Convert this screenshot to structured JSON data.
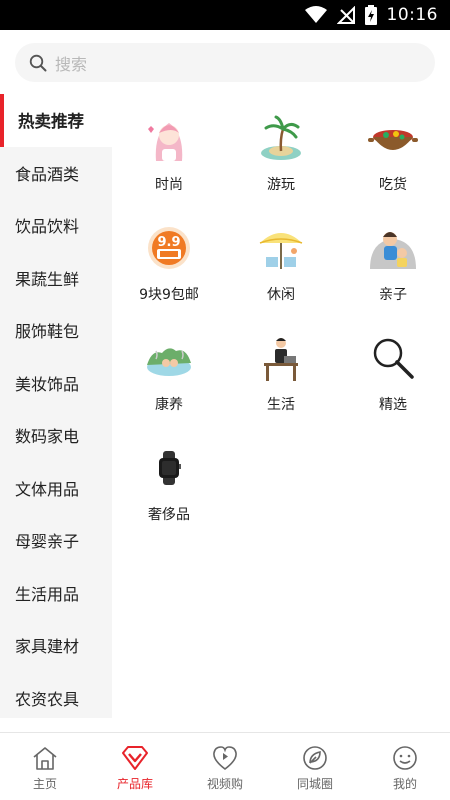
{
  "status_bar": {
    "time": "10:16"
  },
  "search": {
    "placeholder": "搜索"
  },
  "sidebar": {
    "items": [
      {
        "label": "热卖推荐",
        "active": true
      },
      {
        "label": "食品酒类"
      },
      {
        "label": "饮品饮料"
      },
      {
        "label": "果蔬生鲜"
      },
      {
        "label": "服饰鞋包"
      },
      {
        "label": "美妆饰品"
      },
      {
        "label": "数码家电"
      },
      {
        "label": "文体用品"
      },
      {
        "label": "母婴亲子"
      },
      {
        "label": "生活用品"
      },
      {
        "label": "家具建材"
      },
      {
        "label": "农资农具"
      }
    ]
  },
  "categories": [
    {
      "label": "时尚",
      "icon": "fashion-girl-icon"
    },
    {
      "label": "游玩",
      "icon": "island-palm-icon"
    },
    {
      "label": "吃货",
      "icon": "hotpot-icon"
    },
    {
      "label": "9块9包邮",
      "icon": "nine-nine-badge-icon"
    },
    {
      "label": "休闲",
      "icon": "beach-umbrella-icon"
    },
    {
      "label": "亲子",
      "icon": "mother-child-icon"
    },
    {
      "label": "康养",
      "icon": "hot-spring-icon"
    },
    {
      "label": "生活",
      "icon": "office-worker-icon"
    },
    {
      "label": "精选",
      "icon": "magnifier-icon"
    },
    {
      "label": "奢侈品",
      "icon": "smartwatch-icon"
    }
  ],
  "bottom_nav": [
    {
      "label": "主页",
      "icon": "home-icon"
    },
    {
      "label": "产品库",
      "icon": "diamond-icon",
      "active": true
    },
    {
      "label": "视频购",
      "icon": "heart-play-icon"
    },
    {
      "label": "同城圈",
      "icon": "leaf-circle-icon"
    },
    {
      "label": "我的",
      "icon": "smiley-icon"
    }
  ],
  "colors": {
    "accent": "#e8232a",
    "sidebar_bg": "#f5f5f5",
    "search_bg": "#f5f5f5"
  }
}
